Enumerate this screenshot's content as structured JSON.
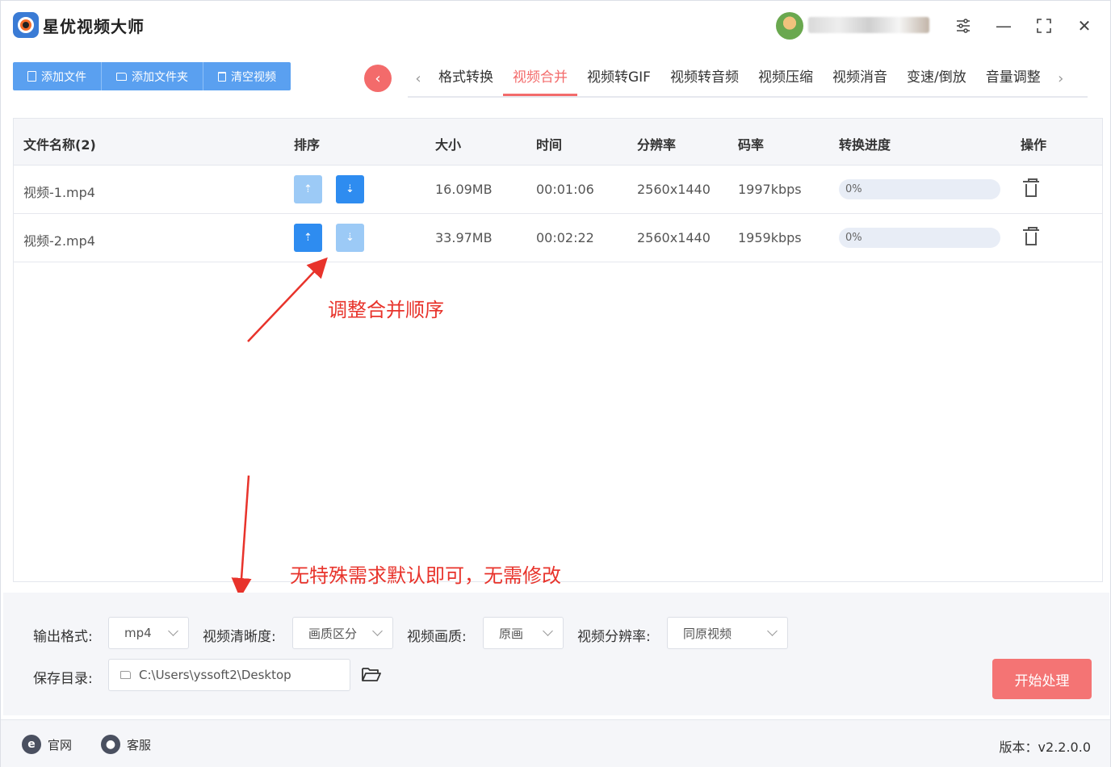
{
  "app": {
    "title": "星优视频大师"
  },
  "window_controls": {
    "settings_icon": "sliders-icon",
    "minimize": "—",
    "maximize": "⛶",
    "close": "✕"
  },
  "toolbar": {
    "add_file": "添加文件",
    "add_folder": "添加文件夹",
    "clear": "清空视频"
  },
  "nav": {
    "back": "‹",
    "prev": "‹",
    "next": "›",
    "tabs": [
      "格式转换",
      "视频合并",
      "视频转GIF",
      "视频转音频",
      "视频压缩",
      "视频消音",
      "变速/倒放",
      "音量调整"
    ],
    "active_tab": "视频合并"
  },
  "table": {
    "headers": [
      "文件名称(2)",
      "排序",
      "大小",
      "时间",
      "分辨率",
      "码率",
      "转换进度",
      "操作"
    ],
    "rows": [
      {
        "name": "视频-1.mp4",
        "size": "16.09MB",
        "time": "00:01:06",
        "resolution": "2560x1440",
        "bitrate": "1997kbps",
        "progress": "0%"
      },
      {
        "name": "视频-2.mp4",
        "size": "33.97MB",
        "time": "00:02:22",
        "resolution": "2560x1440",
        "bitrate": "1959kbps",
        "progress": "0%"
      }
    ]
  },
  "annotations": {
    "order_note": "调整合并顺序",
    "default_note": "无特殊需求默认即可，无需修改",
    "color": "#e8332b"
  },
  "settings": {
    "output_format_label": "输出格式:",
    "output_format": "mp4",
    "clarity_label": "视频清晰度:",
    "clarity": "画质区分",
    "quality_label": "视频画质:",
    "quality": "原画",
    "resolution_label": "视频分辨率:",
    "resolution": "同原视频",
    "save_dir_label": "保存目录:",
    "save_dir": "C:\\Users\\yssoft2\\Desktop",
    "start": "开始处理"
  },
  "statusbar": {
    "website": "官网",
    "support": "客服",
    "version": "版本：v2.2.0.0"
  },
  "colors": {
    "accent": "#f36b6b",
    "primary": "#2e8cf0",
    "toolbar": "#5aa0f0",
    "start_button": "#f47474"
  }
}
